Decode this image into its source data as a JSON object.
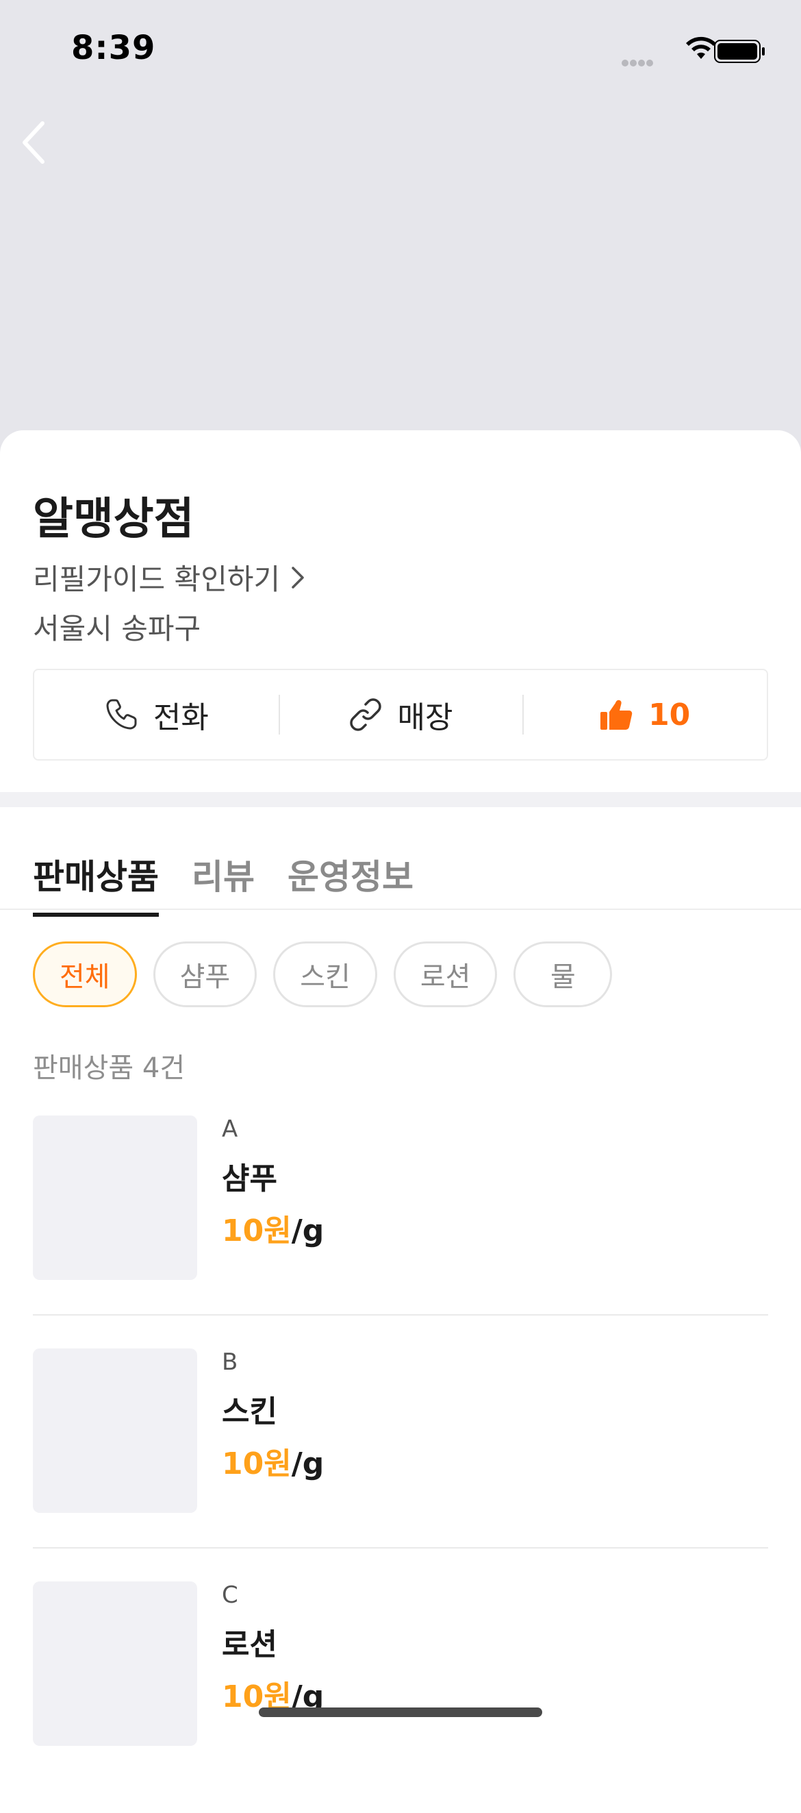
{
  "status_bar": {
    "time": "8:39"
  },
  "store": {
    "name": "알맹상점",
    "guide_link": "리필가이드 확인하기",
    "address": "서울시 송파구"
  },
  "actions": {
    "call_label": "전화",
    "store_label": "매장",
    "like_count": "10"
  },
  "tabs": [
    {
      "label": "판매상품",
      "active": true
    },
    {
      "label": "리뷰",
      "active": false
    },
    {
      "label": "운영정보",
      "active": false
    }
  ],
  "filters": [
    {
      "label": "전체",
      "active": true
    },
    {
      "label": "샴푸",
      "active": false
    },
    {
      "label": "스킨",
      "active": false
    },
    {
      "label": "로션",
      "active": false
    },
    {
      "label": "물",
      "active": false
    }
  ],
  "product_count": "판매상품 4건",
  "products": [
    {
      "brand": "A",
      "name": "샴푸",
      "price": "10원",
      "unit": "/g"
    },
    {
      "brand": "B",
      "name": "스킨",
      "price": "10원",
      "unit": "/g"
    },
    {
      "brand": "C",
      "name": "로션",
      "price": "10원",
      "unit": "/g"
    }
  ],
  "colors": {
    "accent": "#ff6d0c",
    "price": "#ffa11a",
    "hero_bg": "#e6e6eb"
  }
}
